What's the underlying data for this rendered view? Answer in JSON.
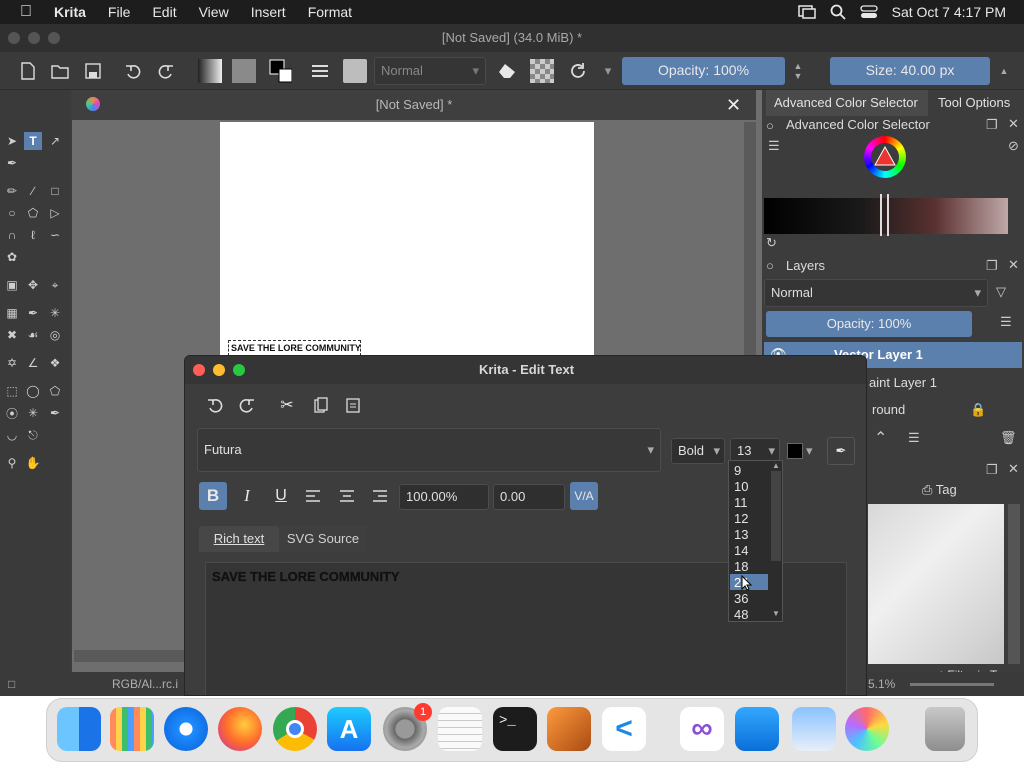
{
  "menubar": {
    "app_name": "Krita",
    "items": [
      "File",
      "Edit",
      "View",
      "Insert",
      "Format"
    ],
    "clock": "Sat Oct 7  4:17 PM"
  },
  "window": {
    "title": "[Not Saved]  (34.0 MiB)  *",
    "doc_tab": "[Not Saved]  *",
    "blend_mode": "Normal",
    "opacity": "Opacity: 100%",
    "size": "Size: 40.00 px"
  },
  "canvas": {
    "text_preview": "SAVE THE LORE COMMUNITY"
  },
  "right_docker": {
    "tabs": [
      "Advanced Color Selector",
      "Tool Options"
    ],
    "color_selector_title": "Advanced Color Selector",
    "layers_title": "Layers",
    "layers_blend": "Normal",
    "layers_opacity": "Opacity:  100%",
    "layers": [
      "Vector Layer 1",
      "Paint Layer 1",
      "Background"
    ],
    "layer_partial": [
      "Vector Layer 1",
      "aint Layer 1",
      "round"
    ],
    "tag_label": "Tag",
    "filter_in_tag": "Filter in Tag"
  },
  "statusbar": {
    "colorspace": "RGB/Al...rc.i",
    "zoom": "5.1%"
  },
  "dialog": {
    "title": "Krita - Edit Text",
    "font_family": "Futura",
    "font_style": "Bold",
    "font_size": "13",
    "line_height": "100.00%",
    "letter_spacing": "0.00",
    "tabs": [
      "Rich text",
      "SVG Source"
    ],
    "active_tab": "Rich text",
    "text_content": "SAVE THE LORE COMMUNITY",
    "size_options": [
      "9",
      "10",
      "11",
      "12",
      "13",
      "14",
      "18",
      "24",
      "36",
      "48"
    ],
    "highlighted_option": "24"
  },
  "dock": {
    "apps": [
      "Finder",
      "Launchpad",
      "Safari",
      "Firefox",
      "Chrome",
      "App Store",
      "System Preferences",
      "TextEdit",
      "Terminal",
      "GarageBand",
      "VS Code",
      "Visual Studio",
      "Cloud App",
      "Preview",
      "Krita",
      "Trash"
    ],
    "badge": "1"
  },
  "colors": {
    "accent": "#5b80ad",
    "panel": "#3c3c3c",
    "canvas": "#6e6e6e",
    "menubar": "#1d1d1d"
  }
}
